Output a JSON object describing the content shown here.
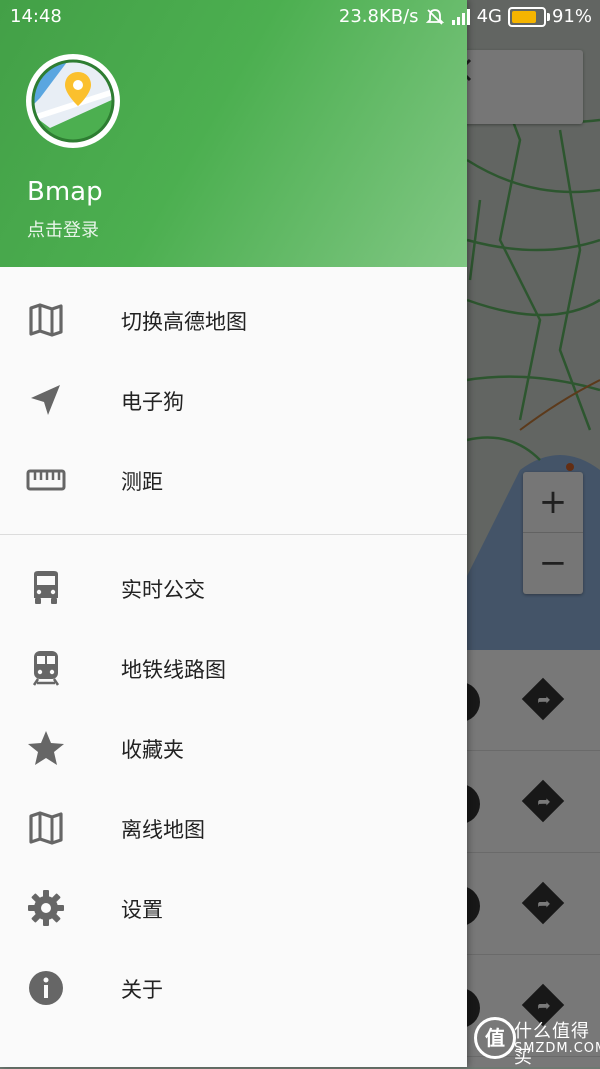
{
  "status_bar": {
    "time": "14:48",
    "net_speed": "23.8KB/s",
    "network": "4G",
    "battery": "91%",
    "battery_level": 0.91,
    "icons": [
      "alarm-off-icon",
      "signal-icon",
      "battery-icon"
    ]
  },
  "drawer": {
    "app_name": "Bmap",
    "login_hint": "点击登录",
    "accent": "#4caf50",
    "sections": [
      {
        "items": [
          {
            "label": "切换高德地图",
            "icon": "map-icon"
          },
          {
            "label": "电子狗",
            "icon": "navigation-icon"
          },
          {
            "label": "测距",
            "icon": "ruler-icon"
          }
        ]
      },
      {
        "items": [
          {
            "label": "实时公交",
            "icon": "bus-icon"
          },
          {
            "label": "地铁线路图",
            "icon": "subway-icon"
          },
          {
            "label": "收藏夹",
            "icon": "star-icon"
          },
          {
            "label": "离线地图",
            "icon": "map-icon"
          },
          {
            "label": "设置",
            "icon": "gear-icon"
          },
          {
            "label": "关于",
            "icon": "info-icon"
          }
        ]
      }
    ]
  },
  "background_map": {
    "zoom_in_label": "+",
    "zoom_out_label": "−",
    "route_rows": 4
  },
  "watermark": {
    "logo_char": "值",
    "text": "什么值得买",
    "domain": "SMZDM.COM"
  }
}
